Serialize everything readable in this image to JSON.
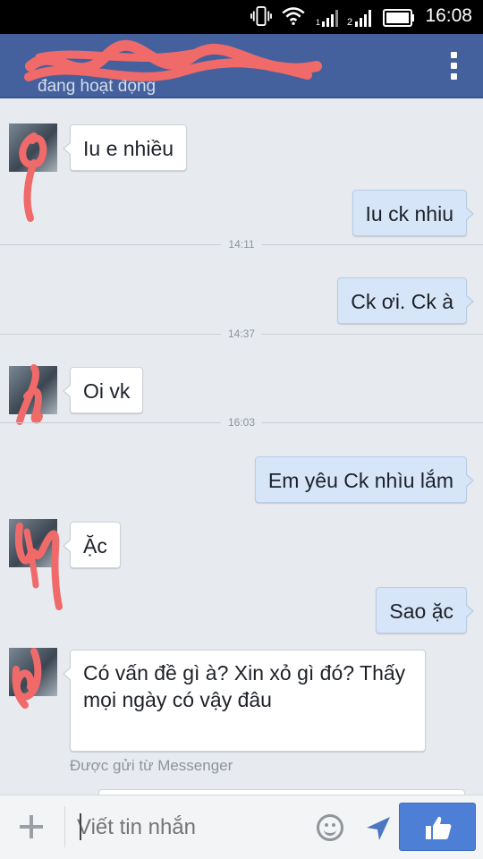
{
  "status_bar": {
    "time": "16:08",
    "icons": [
      "vibrate-icon",
      "wifi-icon",
      "signal-1-icon",
      "signal-2-icon",
      "battery-icon"
    ]
  },
  "header": {
    "title": "",
    "status": "đang hoạt động",
    "menu_icon": "overflow-menu-icon",
    "color": "#44619d"
  },
  "messages": [
    {
      "direction": "in",
      "text": "Iu e nhiều"
    },
    {
      "direction": "out",
      "text": "Iu ck nhiu"
    },
    {
      "direction": "divider",
      "text": "14:11"
    },
    {
      "direction": "out",
      "text": "Ck ơi. Ck à"
    },
    {
      "direction": "divider",
      "text": "14:37"
    },
    {
      "direction": "in",
      "text": "Oi vk"
    },
    {
      "direction": "divider",
      "text": "16:03"
    },
    {
      "direction": "out",
      "text": "Em yêu Ck nhìu lắm"
    },
    {
      "direction": "in",
      "text": "Ặc"
    },
    {
      "direction": "out",
      "text": "Sao ặc"
    },
    {
      "direction": "in",
      "text": "Có vấn đề gì à? Xin xỏ gì đó? Thấy mọi ngày có vậy đâu"
    }
  ],
  "sent_via": "Được gửi từ Messenger",
  "composer": {
    "placeholder": "Viết tin nhắn",
    "icons": [
      "plus-icon",
      "emoji-icon",
      "send-icon",
      "like-icon"
    ],
    "like_color": "#4d7fd6"
  },
  "colors": {
    "background": "#e7ebf0",
    "incoming_bubble": "#ffffff",
    "outgoing_bubble": "#d6e5f7",
    "scribble": "#f06a6a"
  }
}
